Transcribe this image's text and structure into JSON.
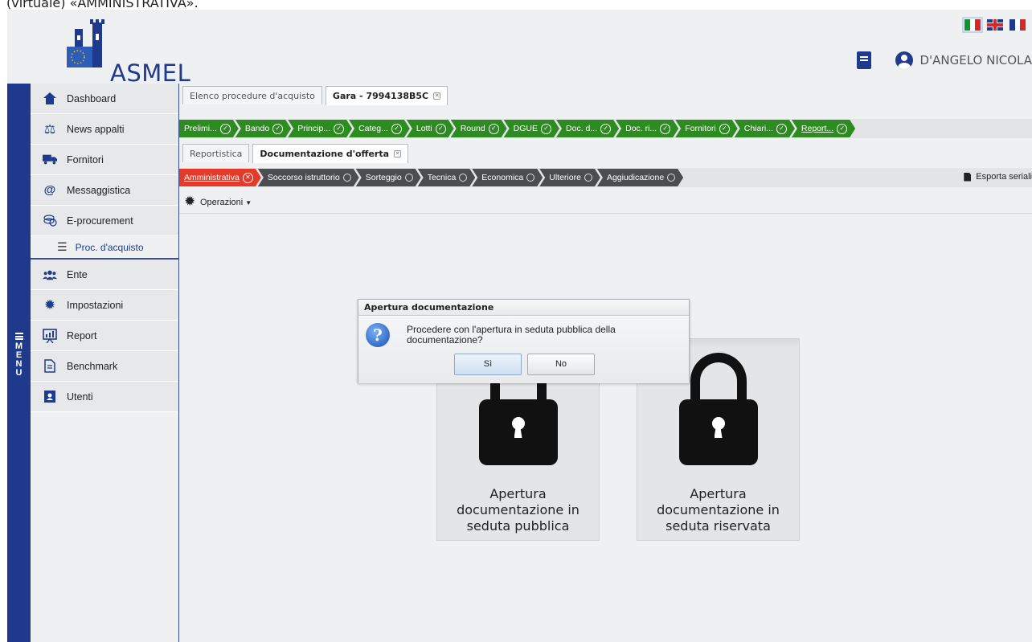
{
  "caption": "(virtuale) «AMMINISTRATIVA».",
  "header": {
    "logo_text": "ASMEL",
    "user_name": "D'ANGELO NICOLA"
  },
  "menu_label": "MENU",
  "sidebar": {
    "items": [
      {
        "label": "Dashboard",
        "icon": "home-icon"
      },
      {
        "label": "News appalti",
        "icon": "scales-icon"
      },
      {
        "label": "Fornitori",
        "icon": "truck-icon"
      },
      {
        "label": "Messaggistica",
        "icon": "at-icon"
      },
      {
        "label": "E-procurement",
        "icon": "coins-icon"
      }
    ],
    "sub_item": {
      "label": "Proc. d'acquisto",
      "icon": "list-icon"
    },
    "items2": [
      {
        "label": "Ente",
        "icon": "users-icon"
      },
      {
        "label": "Impostazioni",
        "icon": "gear-icon"
      },
      {
        "label": "Report",
        "icon": "chart-icon"
      },
      {
        "label": "Benchmark",
        "icon": "document-icon"
      },
      {
        "label": "Utenti",
        "icon": "user-card-icon"
      }
    ]
  },
  "tabs": {
    "elenco": "Elenco procedure d'acquisto",
    "gara": "Gara - 7994138B5C"
  },
  "steps_row1": [
    "Prelimi...",
    "Bando",
    "Princip...",
    "Categ...",
    "Lotti",
    "Round",
    "DGUE",
    "Doc. d...",
    "Doc. ri...",
    "Fornitori",
    "Chiari...",
    "Report..."
  ],
  "subtabs": {
    "reportistica": "Reportistica",
    "documentazione": "Documentazione d'offerta"
  },
  "steps_row2": [
    "Amministrativa",
    "Soccorso istruttorio",
    "Sorteggio",
    "Tecnica",
    "Economica",
    "Ulteriore",
    "Aggiudicazione"
  ],
  "esporta": "Esporta seriali",
  "operazioni": "Operazioni",
  "cards": {
    "pubblica": "Apertura documentazione in seduta pubblica",
    "riservata": "Apertura documentazione in seduta riservata"
  },
  "dialog": {
    "title": "Apertura documentazione",
    "message": "Procedere con l'apertura in seduta pubblica della documentazione?",
    "yes": "Sì",
    "no": "No"
  },
  "colors": {
    "brand_blue": "#1f3a8c",
    "step_green": "#2e8b21",
    "step_dark": "#4b4d50",
    "step_red": "#e53a29"
  }
}
